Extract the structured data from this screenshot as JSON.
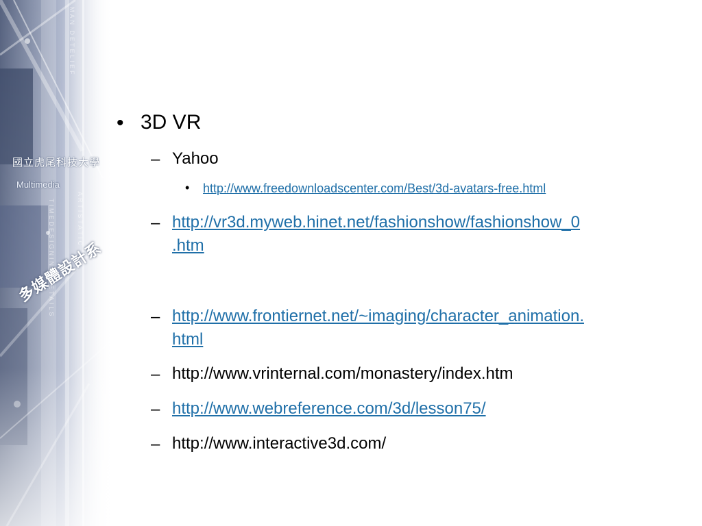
{
  "sidebar": {
    "school_name": "國立虎尾科技大學",
    "subtitle": "Multimedia",
    "department": "多媒體設計系",
    "deco_text_1": "MAN DETELIEF",
    "deco_text_2": "ARTISTATIC",
    "deco_text_3": "TIMEDESIGNING DETAILS",
    "colors": {
      "dark": "#3a4766",
      "mid": "#8a96b4",
      "light": "#d9dfec"
    }
  },
  "slide": {
    "bullet_symbol": "•",
    "dash_symbol": "–",
    "topic": "3D VR",
    "items": [
      {
        "label": "Yahoo",
        "is_link": false
      },
      {
        "label": "http://www.freedownloadscenter.com/Best/3d-avatars-free.html",
        "is_link": true
      },
      {
        "label_line1": "http://vr3d.myweb.hinet.net/fashionshow/fashionshow_0",
        "label_line2": ".htm",
        "is_link": true
      },
      {
        "label_line1": "http://www.frontiernet.net/~imaging/character_animation.",
        "label_line2": "html",
        "is_link": true
      },
      {
        "label": "http://www.vrinternal.com/monastery/index.htm",
        "is_link": false
      },
      {
        "label": "http://www.webreference.com/3d/lesson75/",
        "is_link": true
      },
      {
        "label": "http://www.interactive3d.com/",
        "is_link": false
      }
    ],
    "link_color": "#1f6fa8"
  }
}
